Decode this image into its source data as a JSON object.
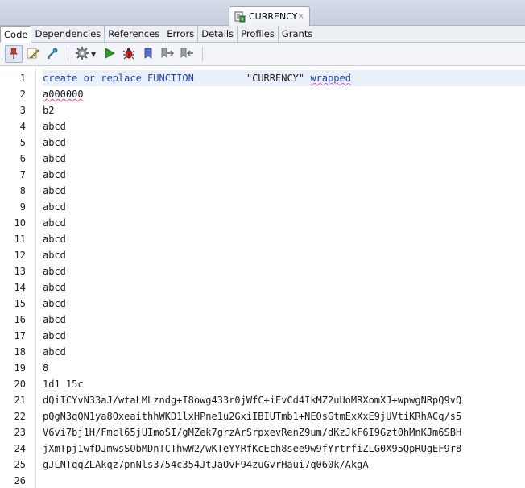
{
  "document_tab": {
    "label": "CURRENCY",
    "close": "×"
  },
  "subtabs": [
    "Code",
    "Dependencies",
    "References",
    "Errors",
    "Details",
    "Profiles",
    "Grants"
  ],
  "active_subtab": "Code",
  "toolbar": {
    "buttons": [
      "pin-icon",
      "edit-icon",
      "recompile-icon",
      "gear-icon",
      "run-icon",
      "debug-icon",
      "bookmark-icon",
      "next-bookmark-icon",
      "prev-bookmark-icon"
    ]
  },
  "code": {
    "line1": {
      "kw1": "create or replace FUNCTION",
      "name": "\"CURRENCY\"",
      "kw2": "wrapped"
    },
    "lines": [
      "a000000",
      "b2",
      "abcd",
      "abcd",
      "abcd",
      "abcd",
      "abcd",
      "abcd",
      "abcd",
      "abcd",
      "abcd",
      "abcd",
      "abcd",
      "abcd",
      "abcd",
      "abcd",
      "abcd",
      "8",
      "1d1 15c",
      "dQiICYvN33aJ/wtaLMLzndg+I8owg433r0jWfC+iEvCd4IkMZ2uUoMRXomXJ+wpwgNRpQ9vQ",
      "pQgN3qQN1ya8OxeaithhWKD1lxHPne1u2GxiIBIUTmb1+NEOsGtmExXxE9jUVtiKRhACq/s5",
      "V6vi7bj1H/Fmcl65jUImoSI/gMZek7grzArSrpxevRenZ9um/dKzJkF6I9Gzt0hMnKJm6SBH",
      "jXmTpj1wfDJmwsSObMDnTCThwW2/wKTeYYRfKcEch8see9w9fYrtrfiZLG0X95QpRUgEF9r8",
      "gJLNTqqZLAkqz7pnNls3754c354JtJaOvF94zuGvrHaui7q060k/AkgA",
      ""
    ],
    "line_numbers": [
      "1",
      "2",
      "3",
      "4",
      "5",
      "6",
      "7",
      "8",
      "9",
      "10",
      "11",
      "12",
      "13",
      "14",
      "15",
      "16",
      "17",
      "18",
      "19",
      "20",
      "21",
      "22",
      "23",
      "24",
      "25",
      "26"
    ]
  }
}
